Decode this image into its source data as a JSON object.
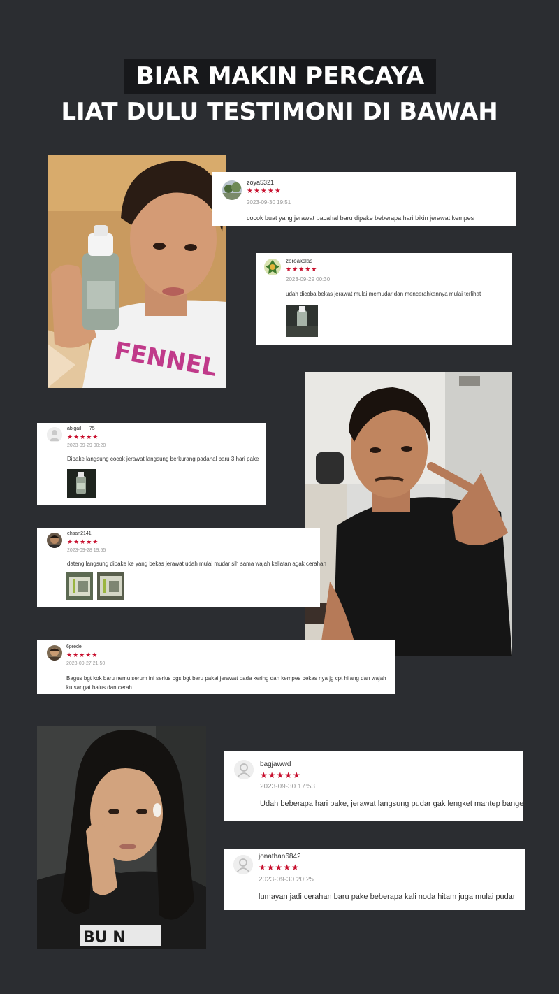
{
  "headline": {
    "line1": "BIAR MAKIN PERCAYA",
    "line2": "LIAT DULU TESTIMONI DI BAWAH"
  },
  "colors": {
    "background": "#2b2d31",
    "star": "#c8102e",
    "banner": "#17181b"
  },
  "reviews": [
    {
      "username": "zoya5321",
      "stars": "★★★★★",
      "time": "2023-09-30 19:51",
      "text": "cocok buat yang jerawat pacahal baru dipake beberapa hari bikin jerawat kempes"
    },
    {
      "username": "zoroakslas",
      "stars": "★★★★★",
      "time": "2023-09-29 00:30",
      "text": "udah dicoba bekas jerawat mulai memudar dan mencerahkannya mulai terlihat"
    },
    {
      "username": "abigail___75",
      "stars": "★★★★★",
      "time": "2023-09-29 00:20",
      "text": "Dipake langsung cocok jerawat langsung berkurang padahal baru 3 hari pake"
    },
    {
      "username": "ehsan2141",
      "stars": "★★★★★",
      "time": "2023-09-28 19:55",
      "text": "dateng langsung dipake ke yang bekas jerawat udah mulai mudar sih sama wajah keliatan agak cerahan"
    },
    {
      "username": "6prede",
      "stars": "★★★★★",
      "time": "2023-09-27 21:50",
      "text": "Bagus bgt kok baru nemu serum ini serius bgs bgt baru pakai jerawat pada kering dan kempes bekas nya jg cpt hilang dan wajah ku sangat halus dan cerah"
    },
    {
      "username": "bagjawwd",
      "stars": "★★★★★",
      "time": "2023-09-30 17:53",
      "text": "Udah beberapa hari pake, jerawat langsung pudar gak lengket mantep banget"
    },
    {
      "username": "jonathan6842",
      "stars": "★★★★★",
      "time": "2023-09-30 20:25",
      "text": "lumayan jadi cerahan baru pake beberapa kali noda hitam juga mulai pudar"
    }
  ],
  "photos": {
    "photo1_shirt_text": "FENNEL",
    "photo3_shirt_text": "BU  N"
  }
}
